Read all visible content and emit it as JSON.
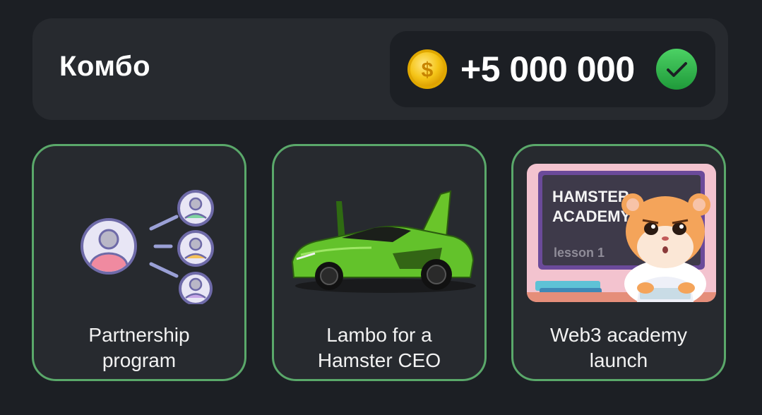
{
  "combo": {
    "title": "Комбо",
    "reward": "+5 000 000",
    "coin_icon": "coin-icon",
    "status_icon": "checkmark-icon",
    "colors": {
      "accent_green": "#5aa86a",
      "check_green": "#2fb14a",
      "coin_gold": "#f5c518"
    }
  },
  "cards": [
    {
      "label": "Partnership\nprogram",
      "icon": "partnership-network-icon"
    },
    {
      "label": "Lambo for a\nHamster CEO",
      "icon": "green-lambo-image"
    },
    {
      "label": "Web3 academy\nlaunch",
      "icon": "hamster-academy-image",
      "image_text": {
        "line1": "HAMSTER",
        "line2": "ACADEMY",
        "line3": "lesson 1"
      }
    }
  ]
}
